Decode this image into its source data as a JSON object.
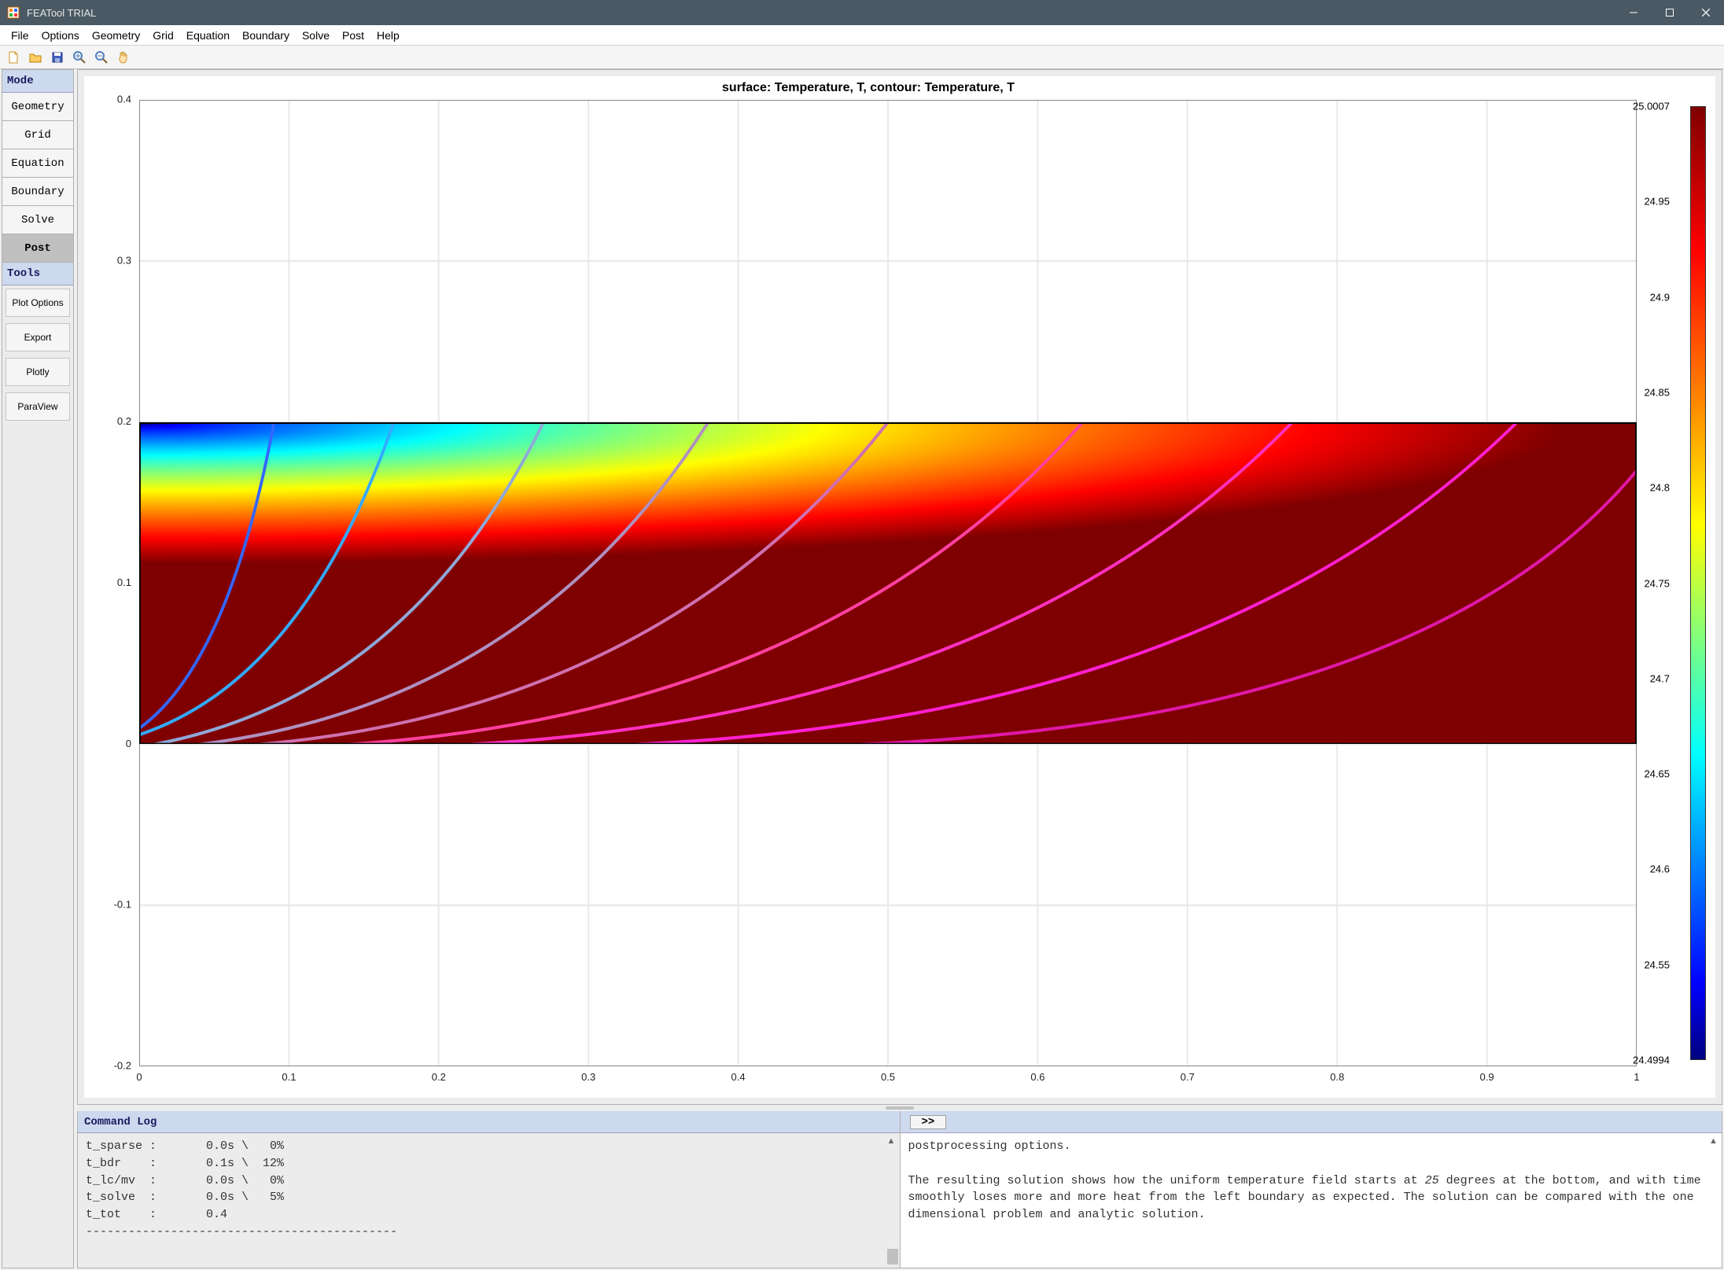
{
  "window": {
    "title": "FEATool TRIAL"
  },
  "menubar": [
    "File",
    "Options",
    "Geometry",
    "Grid",
    "Equation",
    "Boundary",
    "Solve",
    "Post",
    "Help"
  ],
  "toolbar_icons": [
    "new-file-icon",
    "open-folder-icon",
    "save-disk-icon",
    "zoom-in-icon",
    "zoom-out-icon",
    "pan-hand-icon"
  ],
  "sidebar": {
    "mode_header": "Mode",
    "modes": [
      {
        "label": "Geometry",
        "active": false
      },
      {
        "label": "Grid",
        "active": false
      },
      {
        "label": "Equation",
        "active": false
      },
      {
        "label": "Boundary",
        "active": false
      },
      {
        "label": "Solve",
        "active": false
      },
      {
        "label": "Post",
        "active": true
      }
    ],
    "tools_header": "Tools",
    "tools": [
      "Plot Options",
      "Export",
      "Plotly",
      "ParaView"
    ]
  },
  "plot": {
    "title": "surface: Temperature, T, contour: Temperature, T",
    "x_ticks": [
      "0",
      "0.1",
      "0.2",
      "0.3",
      "0.4",
      "0.5",
      "0.6",
      "0.7",
      "0.8",
      "0.9",
      "1"
    ],
    "y_ticks": [
      "-0.2",
      "-0.1",
      "0",
      "0.1",
      "0.2",
      "0.3",
      "0.4"
    ],
    "x_range": [
      0,
      1
    ],
    "y_range": [
      -0.2,
      0.4
    ],
    "data_rect": {
      "x0": 0,
      "x1": 1,
      "y0": 0,
      "y1": 0.2
    },
    "colorbar_ticks": [
      "24.4994",
      "24.55",
      "24.6",
      "24.65",
      "24.7",
      "24.75",
      "24.8",
      "24.85",
      "24.9",
      "24.95",
      "25.0007"
    ]
  },
  "chart_data": {
    "type": "heatmap",
    "title": "surface: Temperature, T, contour: Temperature, T",
    "xlabel": "",
    "ylabel": "",
    "xlim": [
      0,
      1
    ],
    "ylim": [
      -0.2,
      0.4
    ],
    "domain": {
      "x": [
        0,
        1
      ],
      "y": [
        0,
        0.2
      ]
    },
    "colorbar": {
      "min": 24.4994,
      "max": 25.0007,
      "label": "Temperature, T"
    },
    "note": "2D temperature field over rectangular domain; temperature decreases toward top-left (blue) and is near maximum across the right half (dark red). Contour lines (isotherms) curve from lower-left toward upper-right."
  },
  "command_log": {
    "header": "Command Log",
    "lines": [
      "t_sparse :       0.0s \\   0%",
      "t_bdr    :       0.1s \\  12%",
      "t_lc/mv  :       0.0s \\   0%",
      "t_solve  :       0.0s \\   5%",
      "t_tot    :       0.4",
      "--------------------------------------------"
    ]
  },
  "info_panel": {
    "prompt": ">>",
    "text": "postprocessing options.\n\nThe resulting solution shows how the uniform temperature field starts at 25 degrees at the bottom, and with time smoothly loses more and more heat from the left boundary as expected. The solution can be compared with the one dimensional problem and analytic solution."
  }
}
